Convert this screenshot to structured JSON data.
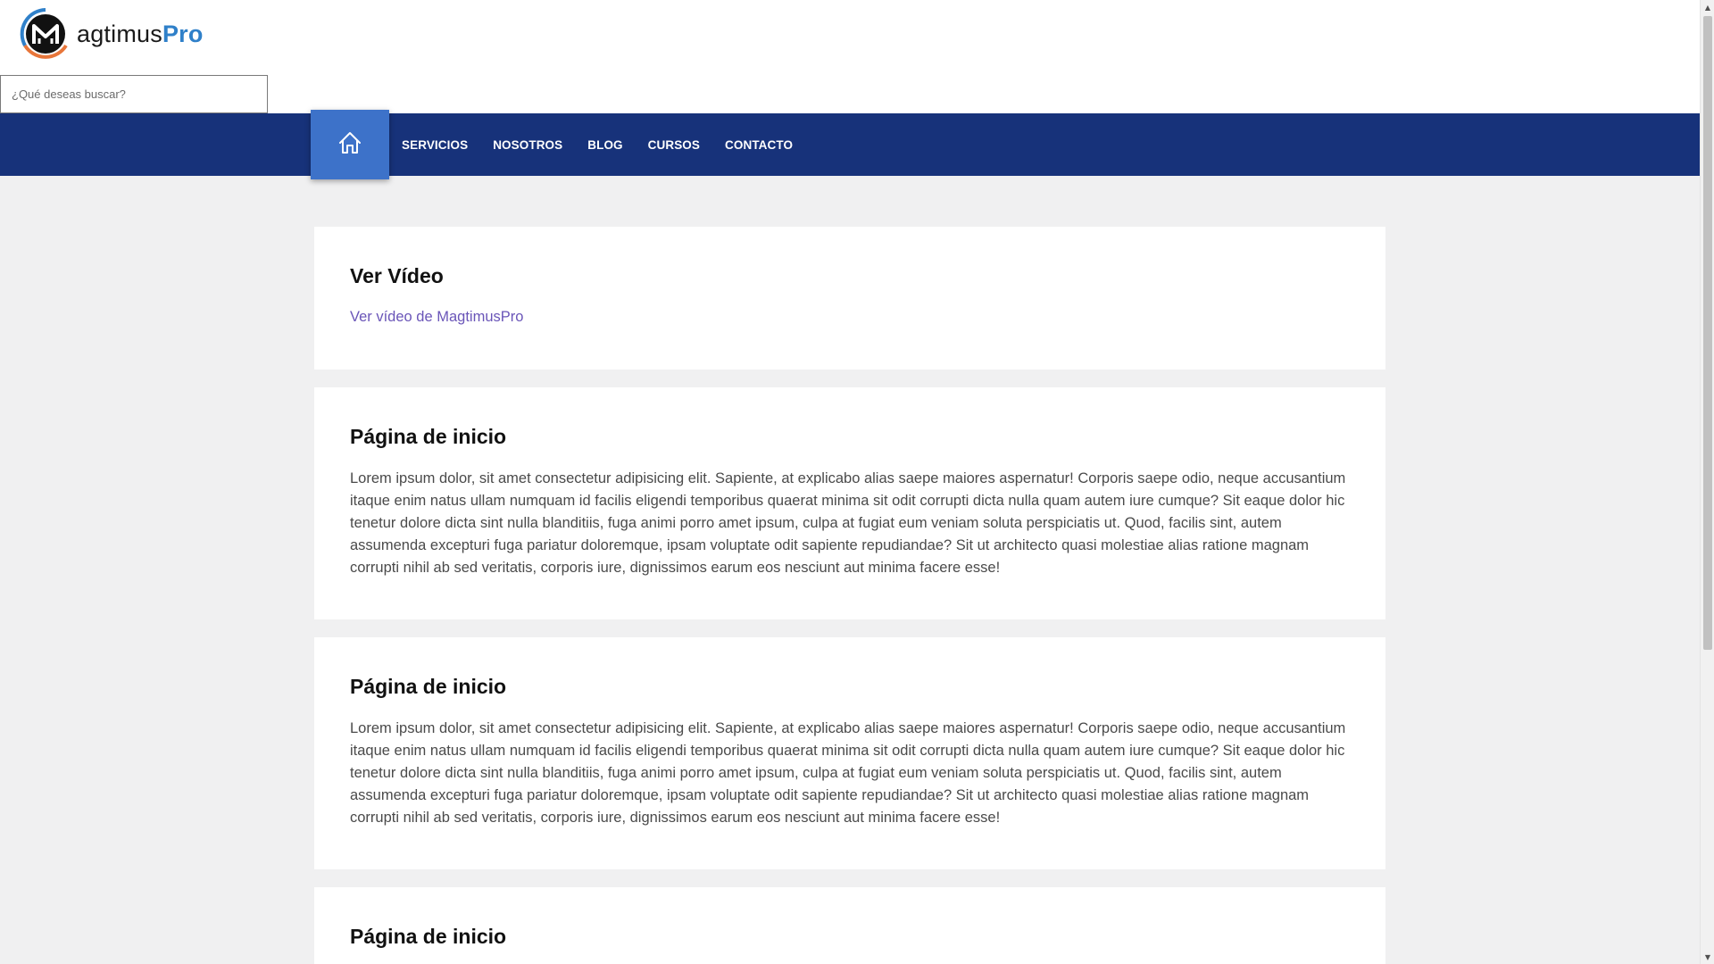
{
  "logo": {
    "text_main": "agtimus",
    "text_accent": "Pro"
  },
  "search": {
    "placeholder": "¿Qué deseas buscar?",
    "value": ""
  },
  "nav": {
    "home_icon": "home-icon",
    "items": [
      "SERVICIOS",
      "NOSOTROS",
      "BLOG",
      "CURSOS",
      "CONTACTO"
    ]
  },
  "cards": [
    {
      "title": "Ver Vídeo",
      "link": "Ver vídeo de MagtimusPro"
    },
    {
      "title": "Página de inicio",
      "body": "Lorem ipsum dolor, sit amet consectetur adipisicing elit. Sapiente, at explicabo alias saepe maiores aspernatur! Corporis saepe odio, neque accusantium itaque enim natus ullam numquam id facilis eligendi temporibus quaerat minima sit odit corrupti dicta nulla quam autem iure cumque? Sit eaque dolor hic tenetur dolore dicta sint nulla blanditiis, fuga animi porro amet ipsum, culpa at fugiat eum veniam soluta perspiciatis ut. Quod, facilis sint, autem assumenda excepturi fuga pariatur doloremque, ipsam voluptate odit sapiente repudiandae? Sit ut architecto quasi molestiae alias ratione magnam corrupti nihil ab sed veritatis, corporis iure, dignissimos earum eos nesciunt aut minima facere esse!"
    },
    {
      "title": "Página de inicio",
      "body": "Lorem ipsum dolor, sit amet consectetur adipisicing elit. Sapiente, at explicabo alias saepe maiores aspernatur! Corporis saepe odio, neque accusantium itaque enim natus ullam numquam id facilis eligendi temporibus quaerat minima sit odit corrupti dicta nulla quam autem iure cumque? Sit eaque dolor hic tenetur dolore dicta sint nulla blanditiis, fuga animi porro amet ipsum, culpa at fugiat eum veniam soluta perspiciatis ut. Quod, facilis sint, autem assumenda excepturi fuga pariatur doloremque, ipsam voluptate odit sapiente repudiandae? Sit ut architecto quasi molestiae alias ratione magnam corrupti nihil ab sed veritatis, corporis iure, dignissimos earum eos nesciunt aut minima facere esse!"
    },
    {
      "title": "Página de inicio"
    }
  ],
  "colors": {
    "nav_bg": "#17327a",
    "home_bg": "#3d72c9",
    "link": "#6a55b8",
    "logo_accent": "#2f80c9",
    "page_bg": "#f0f0f1"
  }
}
